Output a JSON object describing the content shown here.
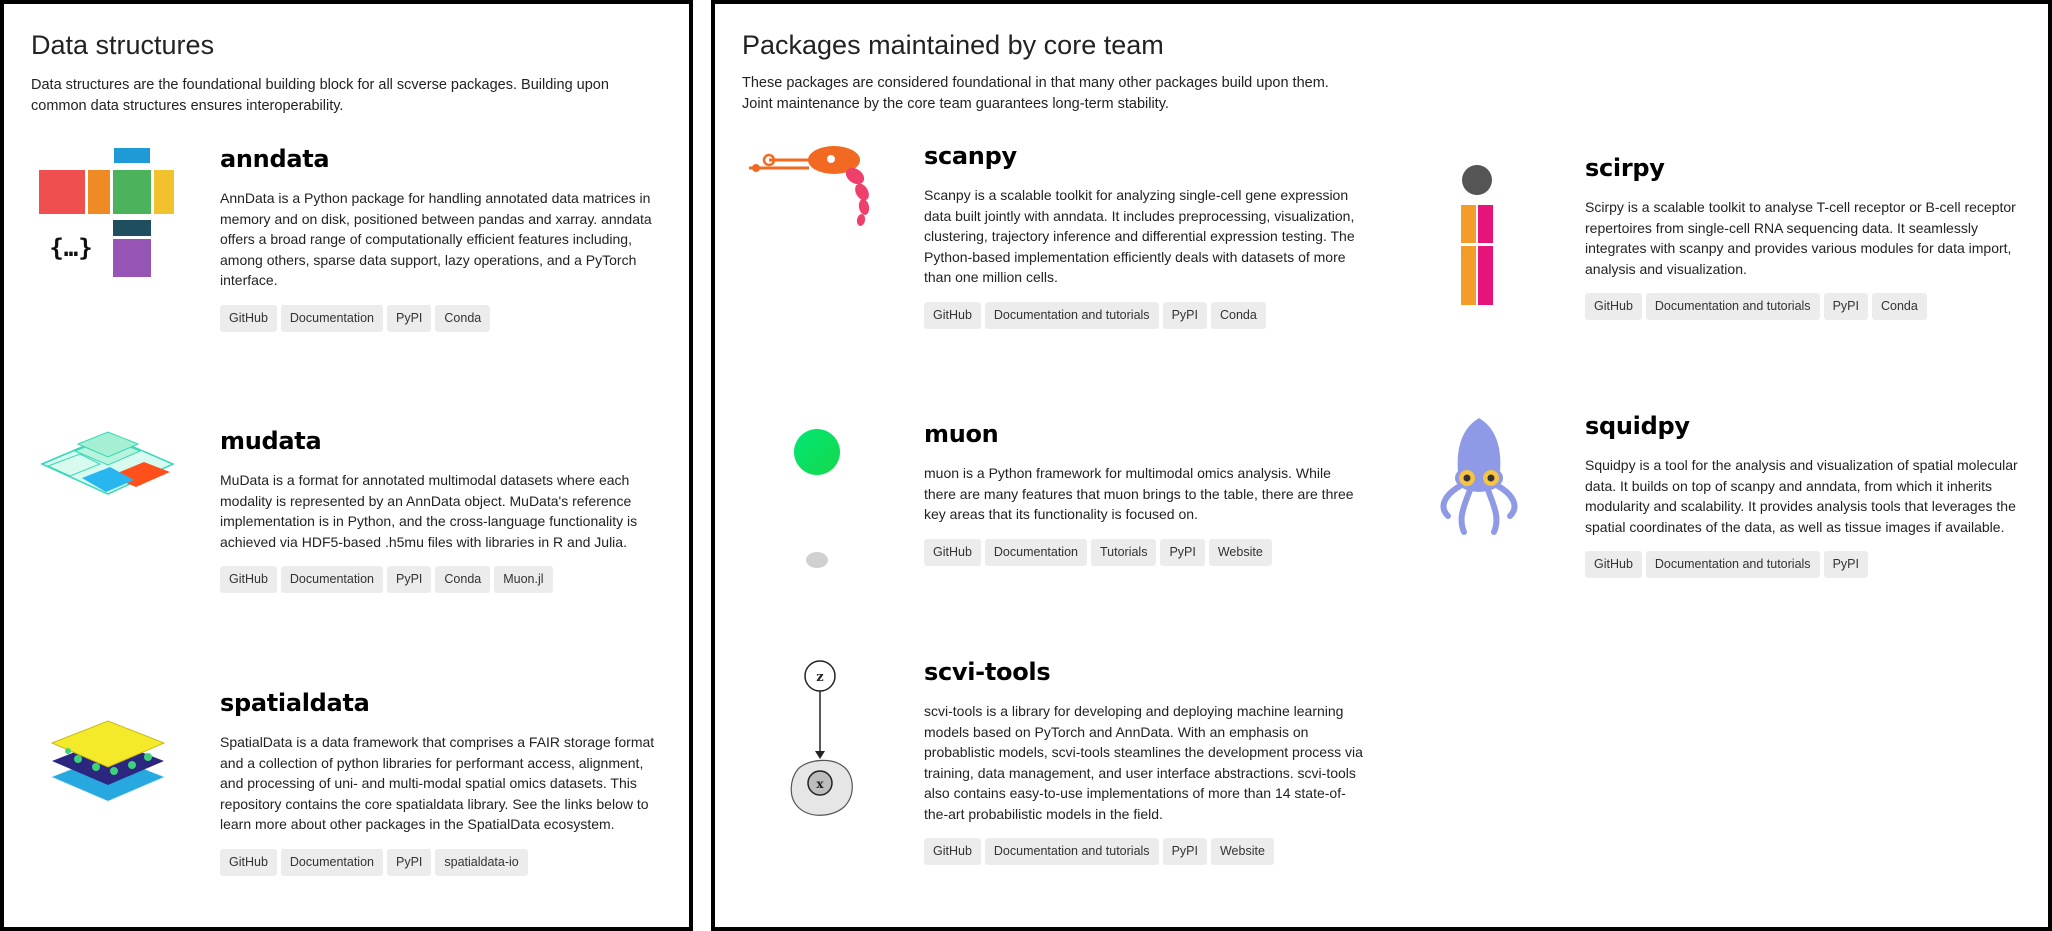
{
  "left": {
    "title": "Data structures",
    "intro": "Data structures are the foundational building block for all scverse packages. Building upon common data structures ensures interoperability.",
    "packages": [
      {
        "name": "anndata",
        "logo": "anndata-logo",
        "description": "AnnData is a Python package for handling annotated data matrices in memory and on disk, positioned between pandas and xarray. anndata offers a broad range of computationally efficient features including, among others, sparse data support, lazy operations, and a PyTorch interface.",
        "links": [
          "GitHub",
          "Documentation",
          "PyPI",
          "Conda"
        ]
      },
      {
        "name": "mudata",
        "logo": "mudata-logo",
        "description": "MuData is a format for annotated multimodal datasets where each modality is represented by an AnnData object. MuData's reference implementation is in Python, and the cross-language functionality is achieved via HDF5-based .h5mu files with libraries in R and Julia.",
        "links": [
          "GitHub",
          "Documentation",
          "PyPI",
          "Conda",
          "Muon.jl"
        ]
      },
      {
        "name": "spatialdata",
        "logo": "spatialdata-logo",
        "description": "SpatialData is a data framework that comprises a FAIR storage format and a collection of python libraries for performant access, alignment, and processing of uni- and multi-modal spatial omics datasets. This repository contains the core spatialdata library. See the links below to learn more about other packages in the SpatialData ecosystem.",
        "links": [
          "GitHub",
          "Documentation",
          "PyPI",
          "spatialdata-io"
        ]
      }
    ]
  },
  "right": {
    "title": "Packages maintained by core team",
    "intro": "These packages are considered foundational in that many other packages build upon them. Joint maintenance by the core team guarantees long-term stability.",
    "packages": [
      {
        "name": "scanpy",
        "logo": "scanpy-logo",
        "description": "Scanpy is a scalable toolkit for analyzing single-cell gene expression data built jointly with anndata. It includes preprocessing, visualization, clustering, trajectory inference and differential expression testing. The Python-based implementation efficiently deals with datasets of more than one million cells.",
        "links": [
          "GitHub",
          "Documentation and tutorials",
          "PyPI",
          "Conda"
        ]
      },
      {
        "name": "scirpy",
        "logo": "scirpy-logo",
        "description": "Scirpy is a scalable toolkit to analyse T-cell receptor or B-cell receptor repertoires from single-cell RNA sequencing data. It seamlessly integrates with scanpy and provides various modules for data import, analysis and visualization.",
        "links": [
          "GitHub",
          "Documentation and tutorials",
          "PyPI",
          "Conda"
        ]
      },
      {
        "name": "muon",
        "logo": "muon-logo",
        "description": "muon is a Python framework for multimodal omics analysis. While there are many features that muon brings to the table, there are three key areas that its functionality is focused on.",
        "links": [
          "GitHub",
          "Documentation",
          "Tutorials",
          "PyPI",
          "Website"
        ]
      },
      {
        "name": "squidpy",
        "logo": "squidpy-logo",
        "description": "Squidpy is a tool for the analysis and visualization of spatial molecular data. It builds on top of scanpy and anndata, from which it inherits modularity and scalability. It provides analysis tools that leverages the spatial coordinates of the data, as well as tissue images if available.",
        "links": [
          "GitHub",
          "Documentation and tutorials",
          "PyPI"
        ]
      },
      {
        "name": "scvi-tools",
        "logo": "scvi-tools-logo",
        "description": "scvi-tools is a library for developing and deploying machine learning models based on PyTorch and AnnData. With an emphasis on probablistic models, scvi-tools steamlines the development process via training, data management, and user interface abstractions. scvi-tools also contains easy-to-use implementations of more than 14 state-of-the-art probabilistic models in the field.",
        "links": [
          "GitHub",
          "Documentation and tutorials",
          "PyPI",
          "Website"
        ]
      }
    ]
  },
  "logo_text": {
    "anndata_braces": "{…}",
    "scvi_latent": "z",
    "scvi_observed": "x"
  },
  "colors": {
    "tag_bg": "#ececec",
    "scanpy_orange": "#f26a21",
    "scanpy_pink": "#ef3f6b",
    "scirpy_orange": "#f39c29",
    "scirpy_pink": "#e5137a",
    "squidpy_purple": "#8f9ae6",
    "muon_green": "#00e676"
  }
}
